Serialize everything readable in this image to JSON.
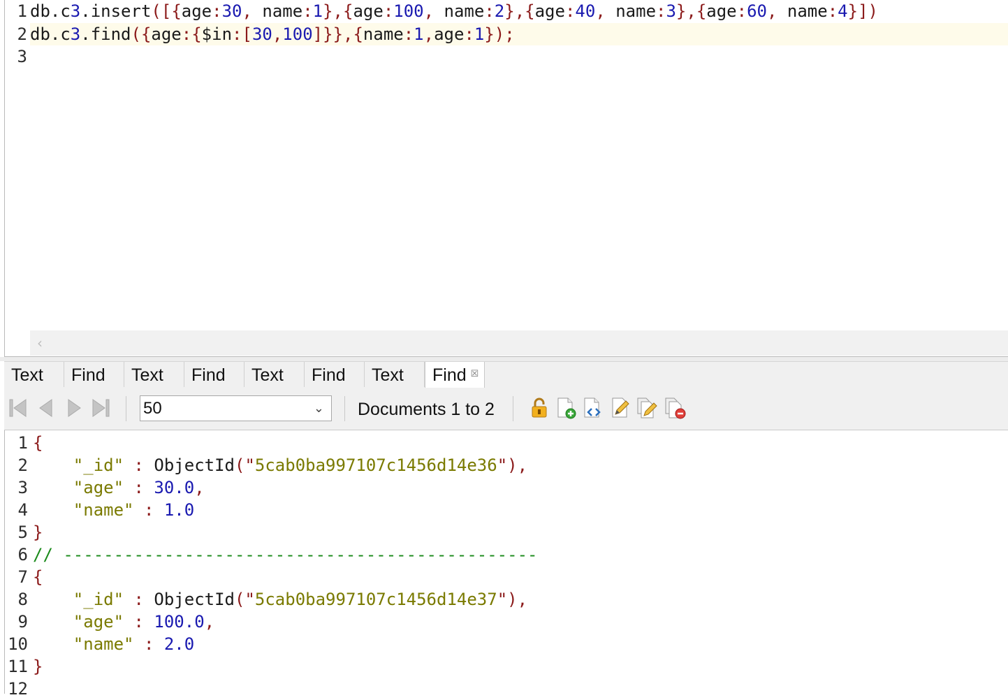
{
  "editor": {
    "lines": [
      {
        "num": "1",
        "code": "db.c3.insert([{age:30, name:1},{age:100, name:2},{age:40, name:3},{age:60, name:4}])"
      },
      {
        "num": "2",
        "code": "db.c3.find({age:{$in:[30,100]}},{name:1,age:1});"
      },
      {
        "num": "3",
        "code": ""
      }
    ],
    "scroll_left_glyph": "‹"
  },
  "tabs": [
    {
      "label": "Text"
    },
    {
      "label": "Find"
    },
    {
      "label": "Text"
    },
    {
      "label": "Find"
    },
    {
      "label": "Text"
    },
    {
      "label": "Find"
    },
    {
      "label": "Text"
    },
    {
      "label": "Find",
      "close": "☒"
    }
  ],
  "toolbar": {
    "page_size": "50",
    "documents_label": "Documents 1 to 2",
    "icons": [
      "first-page-icon",
      "previous-page-icon",
      "next-page-icon",
      "last-page-icon",
      "lock-icon",
      "add-document-icon",
      "view-json-icon",
      "edit-document-icon",
      "edit-multiple-icon",
      "delete-document-icon"
    ]
  },
  "result": {
    "lines": [
      {
        "num": "1",
        "text": "{"
      },
      {
        "num": "2",
        "text": "    \"_id\" : ObjectId(\"5cab0ba997107c1456d14e36\"),"
      },
      {
        "num": "3",
        "text": "    \"age\" : 30.0,"
      },
      {
        "num": "4",
        "text": "    \"name\" : 1.0"
      },
      {
        "num": "5",
        "text": "}"
      },
      {
        "num": "6",
        "text": "// -----------------------------------------------"
      },
      {
        "num": "7",
        "text": "{"
      },
      {
        "num": "8",
        "text": "    \"_id\" : ObjectId(\"5cab0ba997107c1456d14e37\"),"
      },
      {
        "num": "9",
        "text": "    \"age\" : 100.0,"
      },
      {
        "num": "10",
        "text": "    \"name\" : 2.0"
      },
      {
        "num": "11",
        "text": "}"
      },
      {
        "num": "12",
        "text": ""
      }
    ]
  },
  "colors": {
    "punct": "#8b1a1a",
    "number": "#1a1ab0",
    "string": "#7a7a00",
    "comment": "#1a8a1a",
    "current_line": "#fefbea"
  }
}
